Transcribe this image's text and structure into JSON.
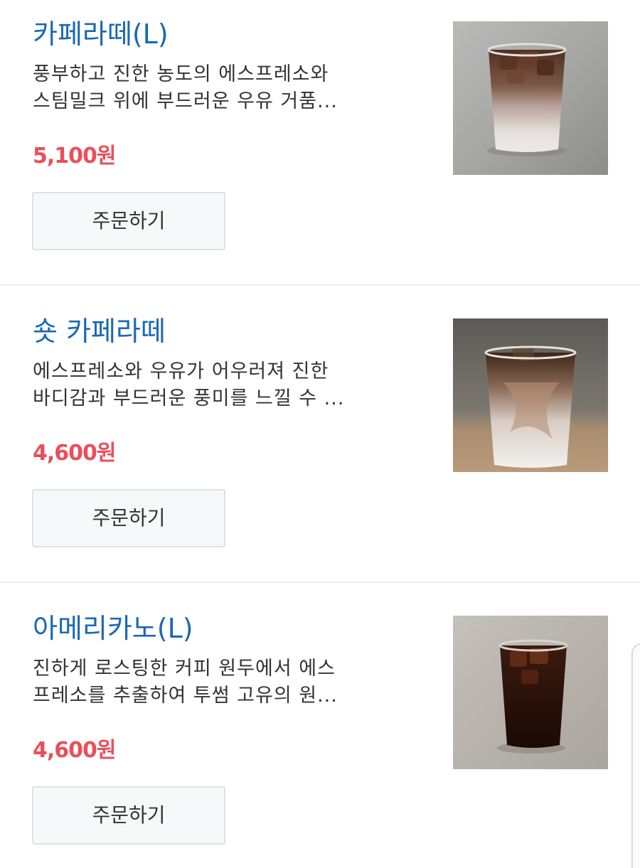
{
  "items": [
    {
      "title": "카페라떼(L)",
      "desc_line1": "풍부하고 진한 농도의 에스프레소와",
      "desc_line2": "스팀밀크 위에 부드러운 우유 거품...",
      "price": "5,100원",
      "order_label": "주문하기",
      "image": "iced-cafe-latte-photo"
    },
    {
      "title": "숏 카페라떼",
      "desc_line1": "에스프레소와 우유가 어우러져 진한",
      "desc_line2": "바디감과 부드러운 풍미를 느낄 수 ...",
      "price": "4,600원",
      "order_label": "주문하기",
      "image": "iced-short-latte-photo"
    },
    {
      "title": "아메리카노(L)",
      "desc_line1": "진하게 로스팅한 커피 원두에서 에스",
      "desc_line2": "프레소를 추출하여 투썸 고유의 원...",
      "price": "4,600원",
      "order_label": "주문하기",
      "image": "iced-americano-photo"
    }
  ],
  "colors": {
    "title": "#1a68b5",
    "price": "#e9505a",
    "button_bg": "#f7f8fa",
    "button_border": "#dde1e6"
  }
}
